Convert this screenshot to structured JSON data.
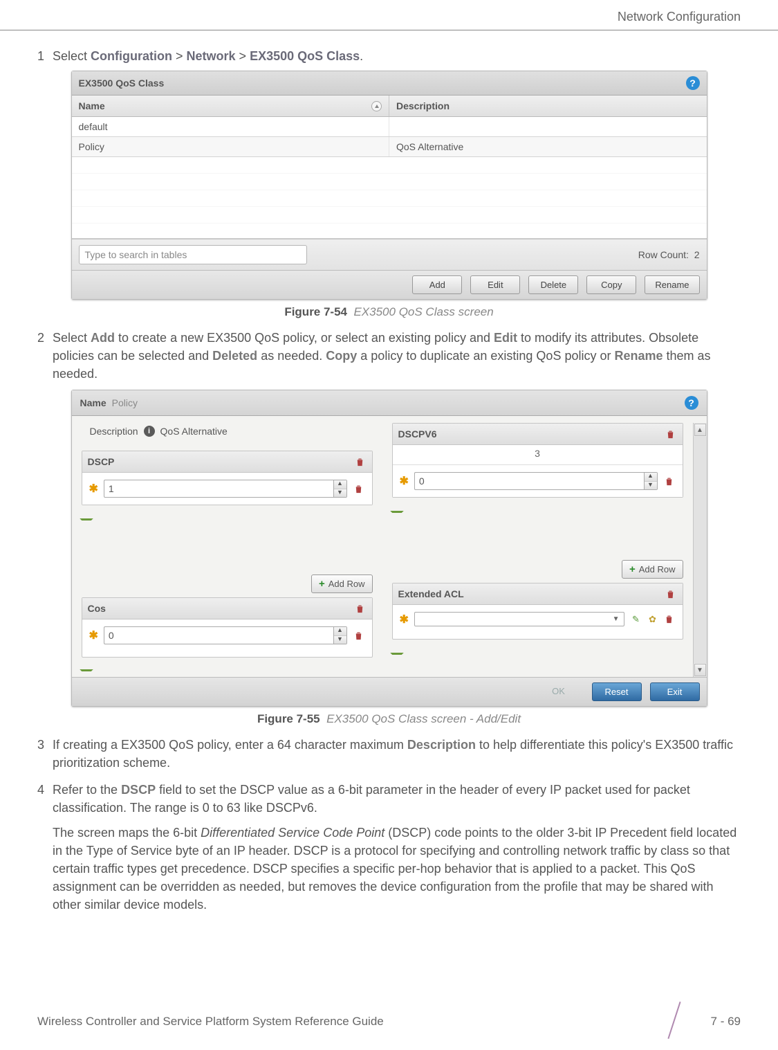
{
  "header": {
    "section": "Network Configuration"
  },
  "steps": {
    "s1_num": "1",
    "s1_pre": "Select ",
    "s1_a": "Configuration",
    "s1_gt1": " > ",
    "s1_b": "Network",
    "s1_gt2": " > ",
    "s1_c": "EX3500 QoS Class",
    "s1_end": ".",
    "s2_num": "2",
    "s2_pre": "Select ",
    "s2_add": "Add",
    "s2_mid1": " to create a new EX3500 QoS policy, or select an existing policy and ",
    "s2_edit": "Edit",
    "s2_mid2": " to modify its attributes. Obsolete policies can be selected and ",
    "s2_del": "Deleted",
    "s2_mid3": " as needed. ",
    "s2_copy": "Copy",
    "s2_mid4": " a policy to duplicate an existing QoS policy or ",
    "s2_ren": "Rename",
    "s2_end": " them as needed.",
    "s3_num": "3",
    "s3_pre": "If creating a EX3500 QoS policy, enter a 64 character maximum ",
    "s3_b": "Description",
    "s3_end": " to help differentiate this policy's EX3500 traffic prioritization scheme.",
    "s4_num": "4",
    "s4_pre": "Refer to the ",
    "s4_b": "DSCP",
    "s4_end": " field to set the DSCP value as a 6-bit parameter in the header of every IP packet used for packet classification. The range is 0 to 63 like DSCPv6.",
    "s4_para2_a": "The screen maps the 6-bit ",
    "s4_para2_i": "Differentiated Service Code Point",
    "s4_para2_b": " (DSCP) code points to the older 3-bit IP Precedent field located in the Type of Service byte of an IP header. DSCP is a protocol for specifying and controlling network traffic by class so that certain traffic types get precedence. DSCP specifies a specific per-hop behavior that is applied to a packet. This QoS assignment can be overridden as needed, but removes the device configuration from the profile that may be shared with other similar device models."
  },
  "fig54": {
    "label": "Figure 7-54",
    "caption": "EX3500 QoS Class screen",
    "title": "EX3500 QoS Class",
    "col_name": "Name",
    "col_desc": "Description",
    "rows": [
      {
        "name": "default",
        "desc": ""
      },
      {
        "name": "Policy",
        "desc": "QoS Alternative"
      }
    ],
    "search_placeholder": "Type to search in tables",
    "rowcount_label": "Row Count:",
    "rowcount": "2",
    "buttons": {
      "add": "Add",
      "edit": "Edit",
      "delete": "Delete",
      "copy": "Copy",
      "rename": "Rename"
    }
  },
  "fig55": {
    "label": "Figure 7-55",
    "caption": "EX3500 QoS Class screen - Add/Edit",
    "name_label": "Name",
    "name_value": "Policy",
    "desc_label": "Description",
    "desc_value": "QoS Alternative",
    "dscp": {
      "title": "DSCP",
      "value": "1"
    },
    "cos": {
      "title": "Cos",
      "value": "0"
    },
    "dscpv6": {
      "title": "DSCPV6",
      "count": "3",
      "value": "0"
    },
    "extacl": {
      "title": "Extended ACL"
    },
    "addrow": "Add Row",
    "buttons": {
      "ok": "OK",
      "reset": "Reset",
      "exit": "Exit"
    }
  },
  "footer": {
    "text": "Wireless Controller and Service Platform System Reference Guide",
    "page": "7 - 69"
  }
}
